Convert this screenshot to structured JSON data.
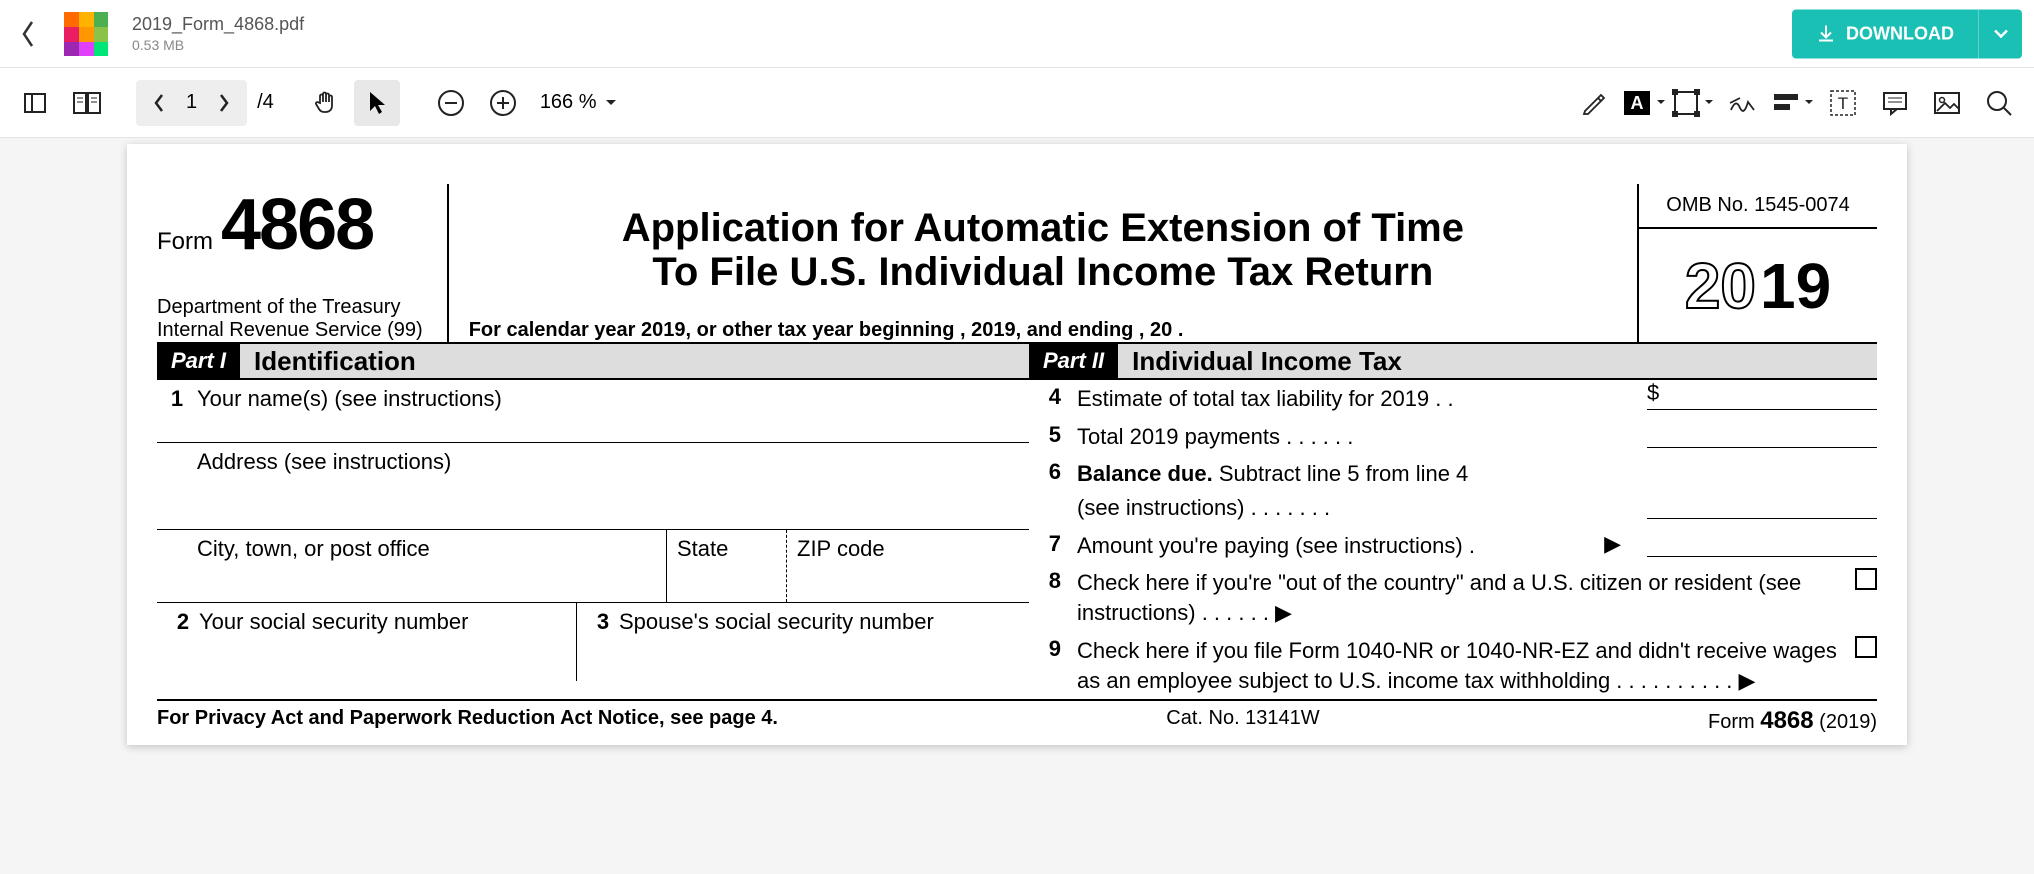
{
  "header": {
    "file_name": "2019_Form_4868.pdf",
    "file_size": "0.53 MB",
    "download_label": "DOWNLOAD"
  },
  "toolbar": {
    "page_current": "1",
    "page_total": "/4",
    "zoom": "166 %"
  },
  "form": {
    "form_word": "Form",
    "form_number": "4868",
    "department1": "Department of the Treasury",
    "department2": "Internal Revenue Service (99)",
    "title_line1": "Application for Automatic Extension of Time",
    "title_line2": "To File U.S. Individual Income Tax Return",
    "tax_year_line": "For calendar year 2019, or other tax year beginning                        , 2019, and ending                    , 20          .",
    "omb": "OMB No. 1545-0074",
    "year_prefix": "20",
    "year_suffix": "19",
    "part1": {
      "badge": "Part I",
      "title": "Identification"
    },
    "part2": {
      "badge": "Part II",
      "title": "Individual Income Tax"
    },
    "left": {
      "r1_num": "1",
      "r1": "Your name(s) (see instructions)",
      "r2": "Address (see instructions)",
      "r3_city": "City, town, or post office",
      "r3_state": "State",
      "r3_zip": "ZIP code",
      "r4_num": "2",
      "r4": "Your social security number",
      "r5_num": "3",
      "r5": "Spouse's social security number"
    },
    "right": {
      "r4_num": "4",
      "r4": "Estimate of total tax liability for 2019 .   .",
      "dollar": "$",
      "r5_num": "5",
      "r5": "Total 2019 payments    .    .    .    .    .    .",
      "r6_num": "6",
      "r6a": "Balance due.",
      "r6b": " Subtract line 5 from line 4",
      "r6c": "(see instructions)    .    .    .    .    .    .    .",
      "r7_num": "7",
      "r7": "Amount you're paying (see instructions) .",
      "r8_num": "8",
      "r8": "Check here if you're \"out of the country\" and a U.S. citizen or resident (see instructions)  .    .    .    .    .    .  ▶",
      "r9_num": "9",
      "r9": "Check here if you file Form 1040-NR or 1040-NR-EZ and didn't receive wages as an employee subject to U.S. income tax withholding .    .    .    .    .    .    .    .    .    .  ▶"
    },
    "footer": {
      "left": "For Privacy Act and Paperwork Reduction Act Notice, see page 4.",
      "cat": "Cat. No. 13141W",
      "right_form": "Form ",
      "right_num": "4868",
      "right_year": " (2019)"
    }
  }
}
